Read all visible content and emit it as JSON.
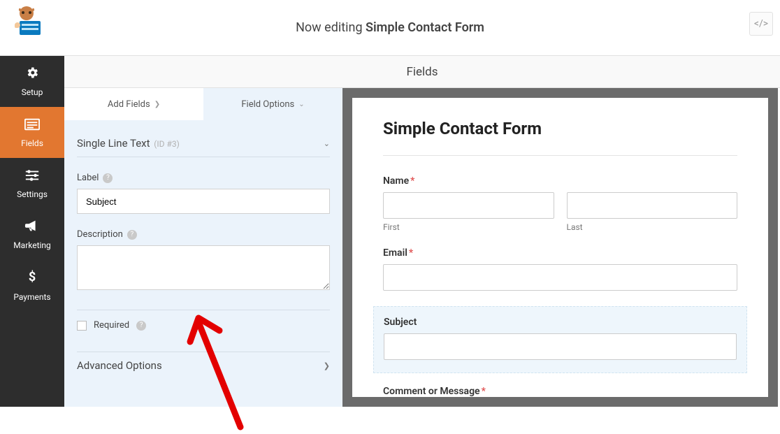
{
  "header": {
    "prefix": "Now editing",
    "form_name": "Simple Contact Form"
  },
  "sec_strip": "Fields",
  "sidebar": {
    "items": [
      {
        "label": "Setup"
      },
      {
        "label": "Fields"
      },
      {
        "label": "Settings"
      },
      {
        "label": "Marketing"
      },
      {
        "label": "Payments"
      }
    ]
  },
  "panel": {
    "tabs": {
      "add": "Add Fields",
      "options": "Field Options"
    },
    "group_title": "Single Line Text",
    "group_id": "(ID #3)",
    "label_label": "Label",
    "label_value": "Subject",
    "desc_label": "Description",
    "required_label": "Required",
    "advanced": "Advanced Options"
  },
  "preview": {
    "title": "Simple Contact Form",
    "fields": {
      "name": {
        "label": "Name",
        "first_sub": "First",
        "last_sub": "Last"
      },
      "email": {
        "label": "Email"
      },
      "subject": {
        "label": "Subject"
      },
      "message": {
        "label": "Comment or Message"
      }
    }
  }
}
